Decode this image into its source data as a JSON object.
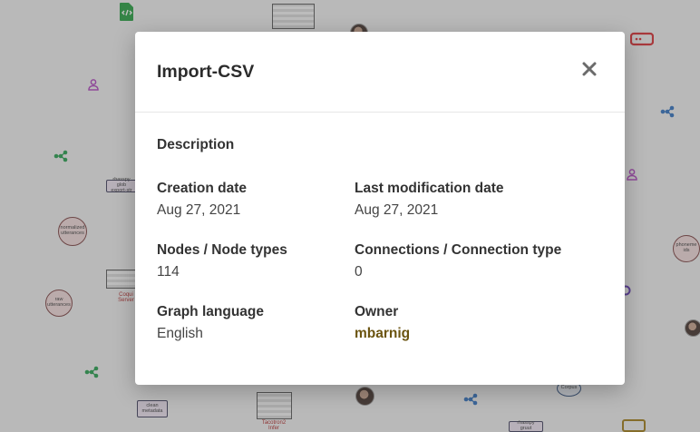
{
  "modal": {
    "title": "Import-CSV",
    "close_icon": "close-icon",
    "description_label": "Description",
    "creation_date_label": "Creation date",
    "creation_date_value": "Aug 27, 2021",
    "last_modification_label": "Last modification date",
    "last_modification_value": "Aug 27, 2021",
    "nodes_label": "Nodes / Node types",
    "nodes_value": "114",
    "connections_label": "Connections / Connection type",
    "connections_value": "0",
    "graph_language_label": "Graph language",
    "graph_language_value": "English",
    "owner_label": "Owner",
    "owner_value": "mbarnig",
    "owner_color": "#6b5410"
  },
  "background": {
    "nodes": {
      "normalized_utterances": "normalized utterances",
      "raw_utterances": "raw utterances",
      "rhasspy_export": "rhasspy glob export-str",
      "coqui_server": "Coqui Server",
      "clean_metadata": "clean metadata",
      "tacotron2_infer": "Tacotron2 Infer",
      "phoneme_ids": "phoneme ids",
      "corpus": "Corpus",
      "rhasspy_gruut": "rhasspy gruut"
    }
  }
}
